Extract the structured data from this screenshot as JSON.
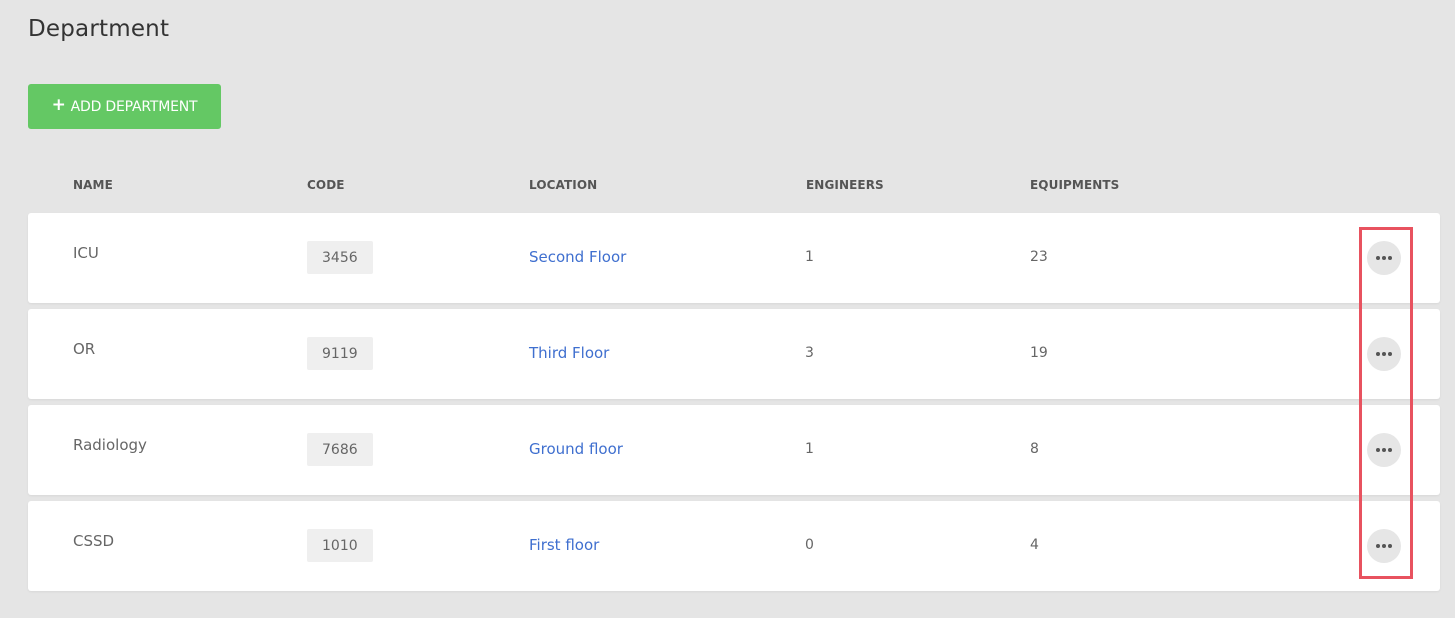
{
  "page": {
    "title": "Department"
  },
  "toolbar": {
    "add_icon": "+",
    "add_label": "ADD DEPARTMENT",
    "add_color": "#64c864"
  },
  "table": {
    "columns": [
      "NAME",
      "CODE",
      "LOCATION",
      "ENGINEERS",
      "EQUIPMENTS"
    ],
    "rows": [
      {
        "name": "ICU",
        "code": "3456",
        "location": "Second Floor",
        "engineers": "1",
        "equipments": "23"
      },
      {
        "name": "OR",
        "code": "9119",
        "location": "Third Floor",
        "engineers": "3",
        "equipments": "19"
      },
      {
        "name": "Radiology",
        "code": "7686",
        "location": "Ground floor",
        "engineers": "1",
        "equipments": "8"
      },
      {
        "name": "CSSD",
        "code": "1010",
        "location": "First floor",
        "engineers": "0",
        "equipments": "4"
      }
    ],
    "row_action_icon": "more-horizontal-icon"
  },
  "annotation": {
    "highlight_color": "#e8525f",
    "highlight_target": "row-actions-column"
  },
  "colors": {
    "background": "#e5e5e5",
    "link": "#3f6fcf"
  }
}
